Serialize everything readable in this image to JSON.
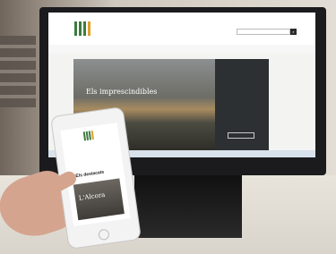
{
  "scene": {
    "website": {
      "hero_title": "Els imprescindibles"
    },
    "phone": {
      "heading": "Els destacats",
      "card_title": "L'Alcora"
    }
  }
}
